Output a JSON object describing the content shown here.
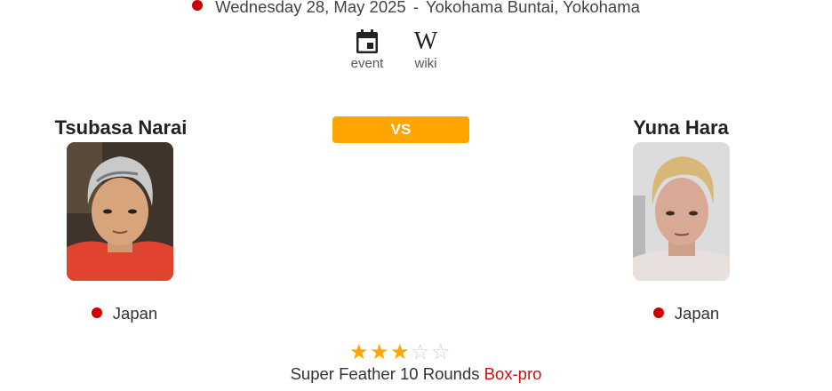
{
  "event": {
    "date": "Wednesday 28, May 2025",
    "separator": "-",
    "venue": "Yokohama Buntai, Yokohama"
  },
  "links": {
    "event_label": "event",
    "event_icon": "calendar-icon",
    "wiki_label": "wiki",
    "wiki_glyph": "W",
    "wiki_icon": "wikipedia-icon"
  },
  "vs_label": "VS",
  "fighters": [
    {
      "name": "Tsubasa Narai",
      "country": "Japan"
    },
    {
      "name": "Yuna Hara",
      "country": "Japan"
    }
  ],
  "rating": {
    "stars": 3,
    "max": 5,
    "filled_color": "#ffa400",
    "empty_color": "#d0d0d0"
  },
  "fight": {
    "weight_rounds": "Super Feather 10 Rounds",
    "sport": "Box-pro"
  },
  "colors": {
    "accent": "#ffa400",
    "status_dot": "#cc0000",
    "sport_link": "#cc1111"
  }
}
